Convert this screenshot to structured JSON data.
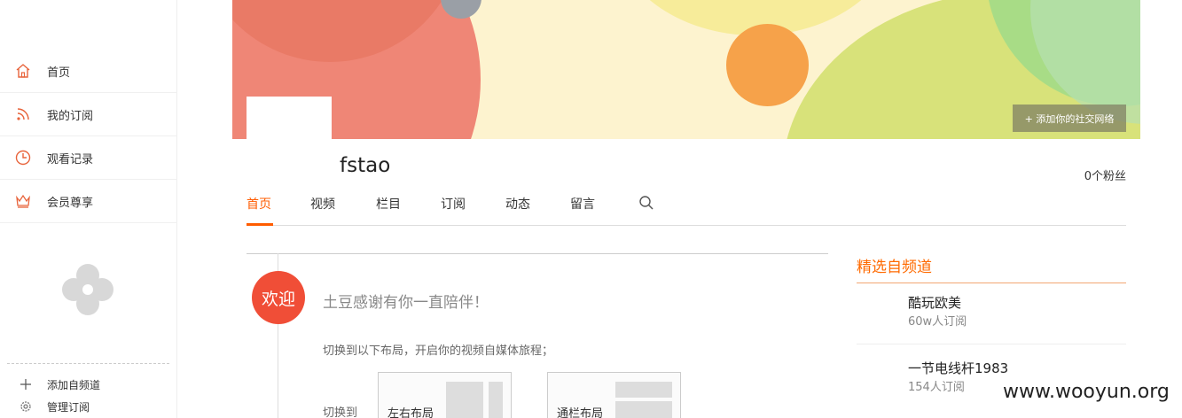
{
  "sidebar": {
    "items": [
      {
        "label": "首页",
        "icon": "home-icon"
      },
      {
        "label": "我的订阅",
        "icon": "rss-icon"
      },
      {
        "label": "观看记录",
        "icon": "clock-icon"
      },
      {
        "label": "会员尊享",
        "icon": "crown-icon"
      }
    ],
    "empty_icon": "flower-placeholder-icon",
    "footer": [
      {
        "label": "添加自频道",
        "icon": "plus-icon"
      },
      {
        "label": "管理订阅",
        "icon": "gear-icon"
      }
    ]
  },
  "banner": {
    "add_social": "+ 添加你的社交网络"
  },
  "profile": {
    "username": "fstao",
    "fans": "0个粉丝"
  },
  "tabs": [
    "首页",
    "视频",
    "栏目",
    "订阅",
    "动态",
    "留言"
  ],
  "active_tab": "首页",
  "welcome": {
    "badge": "欢迎",
    "thanks": "土豆感谢有你一直陪伴！",
    "hint": "切换到以下布局，开启你的视频自媒体旅程；",
    "switch_to": "切换到",
    "layouts": [
      "左右布局",
      "通栏布局"
    ]
  },
  "featured": {
    "title": "精选自频道",
    "channels": [
      {
        "name": "酷玩欧美",
        "subs": "60w人订阅"
      },
      {
        "name": "一节电线杆1983",
        "subs": "154人订阅"
      }
    ]
  },
  "watermark": "www.wooyun.org",
  "colors": {
    "accent": "#ff5c00",
    "badge": "#f04e37"
  }
}
